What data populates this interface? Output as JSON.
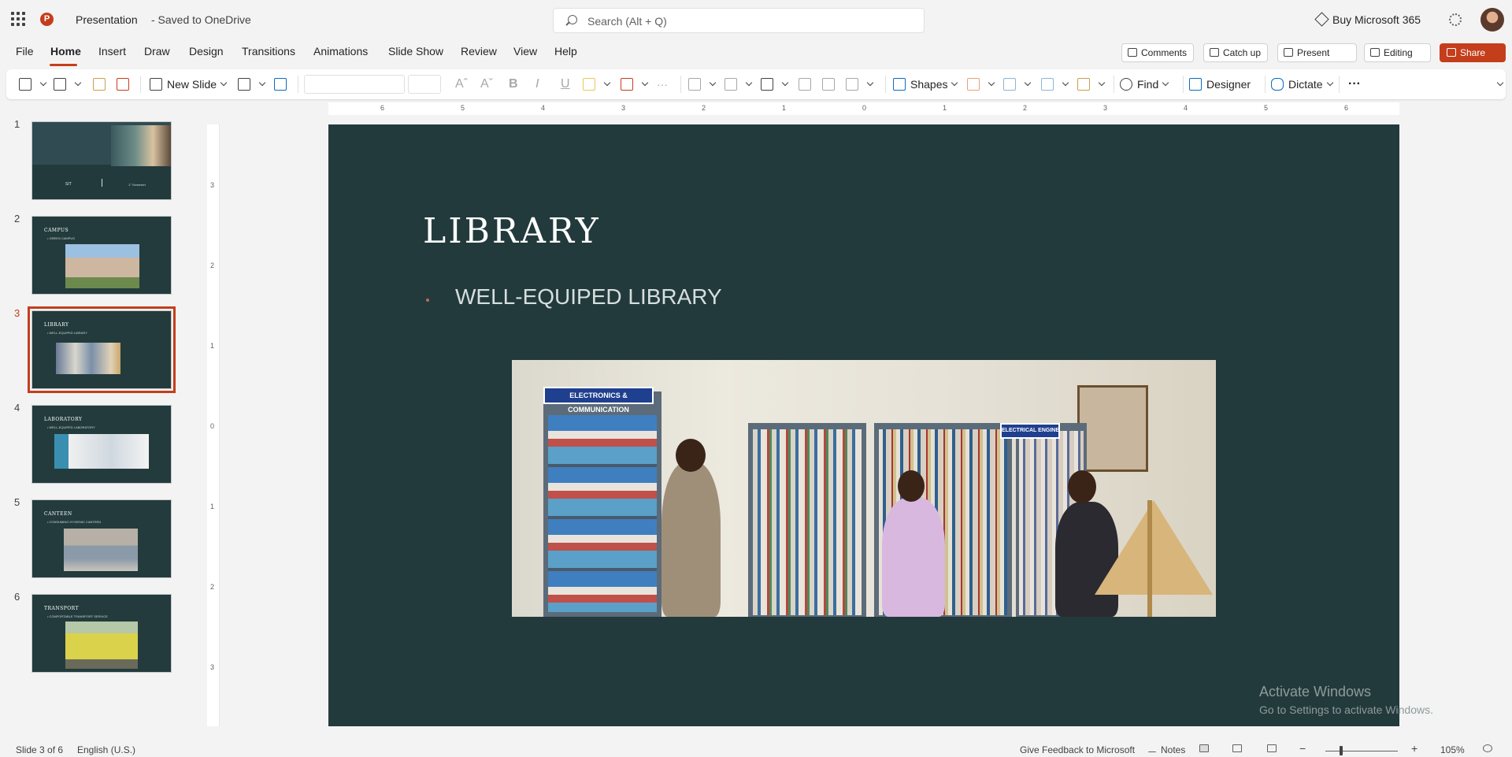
{
  "app": {
    "doc_title": "Presentation",
    "doc_saved": "-  Saved to OneDrive",
    "search_placeholder": "Search (Alt + Q)",
    "buy": "Buy Microsoft 365"
  },
  "menu": {
    "tabs": [
      "File",
      "Home",
      "Insert",
      "Draw",
      "Design",
      "Transitions",
      "Animations",
      "Slide Show",
      "Review",
      "View",
      "Help"
    ],
    "active_tab": "Home",
    "comments": "Comments",
    "catchup": "Catch up",
    "present": "Present",
    "editing": "Editing",
    "share": "Share"
  },
  "ribbon": {
    "new_slide": "New Slide",
    "shapes": "Shapes",
    "find": "Find",
    "designer": "Designer",
    "dictate": "Dictate",
    "more": "···",
    "font_grow": "Aˆ",
    "font_shrink": "Aˇ",
    "bold": "B",
    "italic": "I",
    "underline": "U"
  },
  "ruler": {
    "h_ticks": [
      "6",
      "5",
      "4",
      "3",
      "2",
      "1",
      "0",
      "1",
      "2",
      "3",
      "4",
      "5",
      "6"
    ],
    "v_ticks": [
      "3",
      "2",
      "1",
      "0",
      "1",
      "2",
      "3"
    ]
  },
  "thumbnails": [
    {
      "num": "1",
      "title": "",
      "bullet": "",
      "caption_left": "SIT",
      "caption_right": "1° Semester"
    },
    {
      "num": "2",
      "title": "CAMPUS",
      "bullet": "•  GREEN CAMPUS"
    },
    {
      "num": "3",
      "title": "LIBRARY",
      "bullet": "•  WELL-EQUIPED LIBRARY"
    },
    {
      "num": "4",
      "title": "LABORATORY",
      "bullet": "•  WELL-EQUIPED LABORATORY"
    },
    {
      "num": "5",
      "title": "CANTEEN",
      "bullet": "•  CONSUMING HYGIENIC CANTEEN"
    },
    {
      "num": "6",
      "title": "TRANSPORT",
      "bullet": "•  COMFORTABLE TRANSPORT SERVICE"
    }
  ],
  "selected_slide": "3",
  "slide": {
    "title": "LIBRARY",
    "bullet": "WELL-EQUIPED LIBRARY",
    "photo_signs": [
      "ELECTRONICS & COMMUNICATION",
      "ELECTRICAL ENGINEERING"
    ]
  },
  "watermark": {
    "line1": "Activate Windows",
    "line2": "Go to Settings to activate Windows."
  },
  "status": {
    "slide_count": "Slide 3 of 6",
    "language": "English (U.S.)",
    "feedback": "Give Feedback to Microsoft",
    "notes": "Notes",
    "zoom": "105%"
  },
  "colors": {
    "accent": "#c43e1c",
    "slide_bg": "#233a3c"
  }
}
